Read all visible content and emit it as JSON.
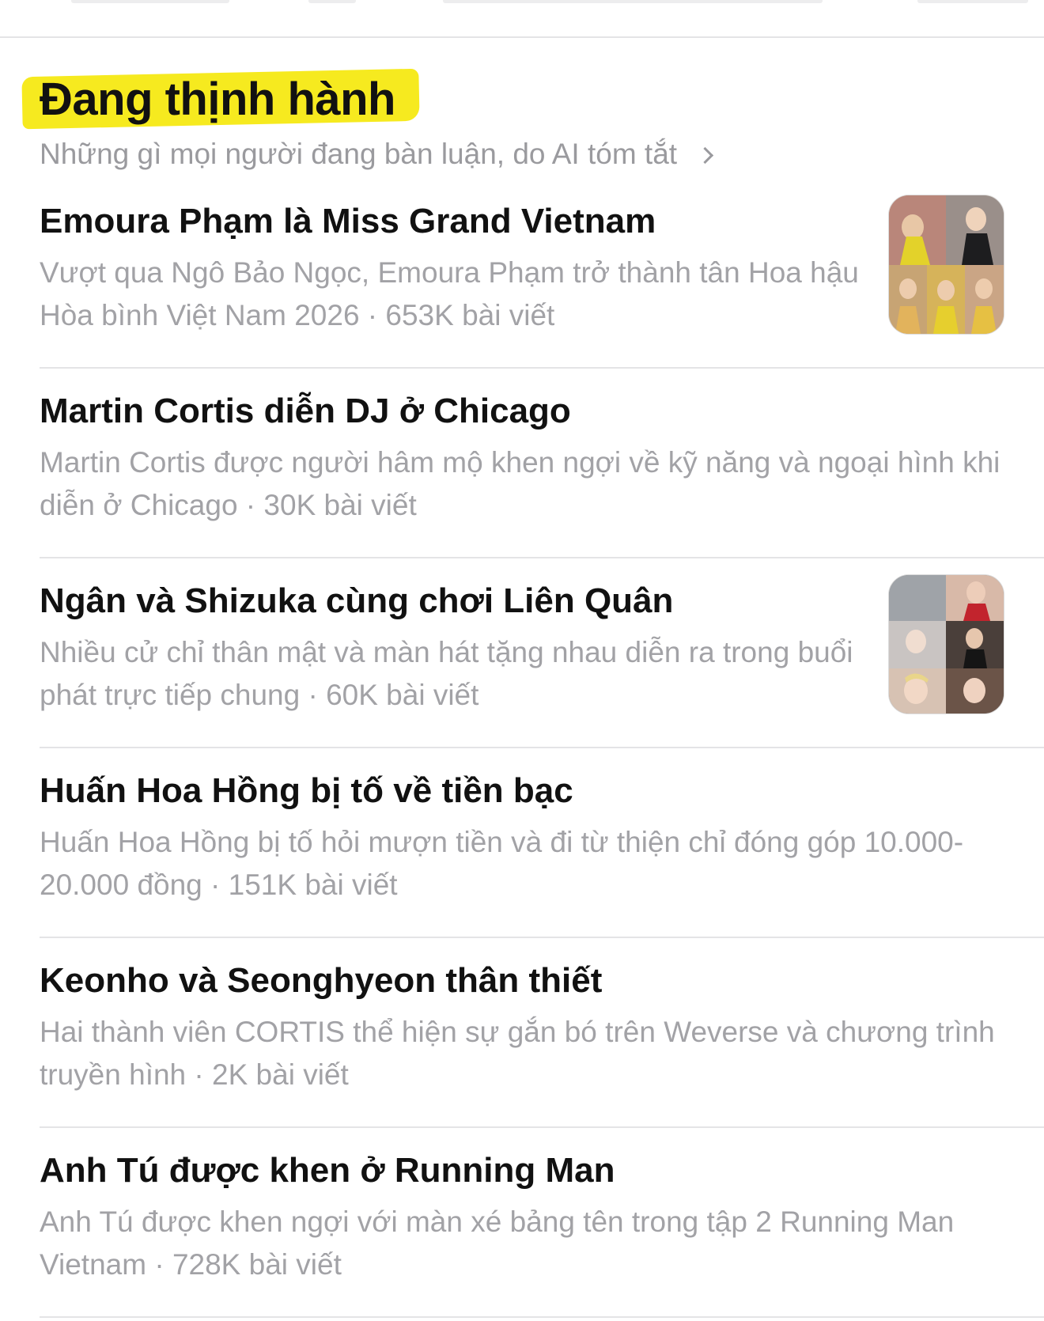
{
  "section": {
    "title": "Đang thịnh hành",
    "subtitle": "Những gì mọi người đang bàn luận, do AI tóm tắt",
    "subtitle_icon": "chevron-right-icon",
    "highlight_color": "#f6ea1f"
  },
  "trends": [
    {
      "title": "Emoura Phạm là Miss Grand Vietnam",
      "description": "Vượt qua Ngô Bảo Ngọc, Emoura Phạm trở thành tân Hoa hậu Hòa bình Việt Nam 2026 · 653K bài viết",
      "has_thumbnail": true
    },
    {
      "title": "Martin Cortis diễn DJ ở Chicago",
      "description": "Martin Cortis được người hâm mộ khen ngợi về kỹ năng và ngoại hình khi diễn ở Chicago · 30K bài viết",
      "has_thumbnail": false
    },
    {
      "title": "Ngân và Shizuka cùng chơi Liên Quân",
      "description": "Nhiều cử chỉ thân mật và màn hát tặng nhau diễn ra trong buổi phát trực tiếp chung · 60K bài viết",
      "has_thumbnail": true
    },
    {
      "title": "Huấn Hoa Hồng bị tố về tiền bạc",
      "description": "Huấn Hoa Hồng bị tố hỏi mượn tiền và đi từ thiện chỉ đóng góp 10.000-20.000 đồng · 151K bài viết",
      "has_thumbnail": false
    },
    {
      "title": "Keonho và Seonghyeon thân thiết",
      "description": "Hai thành viên CORTIS thể hiện sự gắn bó trên Weverse và chương trình truyền hình · 2K bài viết",
      "has_thumbnail": false
    },
    {
      "title": "Anh Tú được khen ở Running Man",
      "description": "Anh Tú được khen ngợi với màn xé bảng tên trong tập 2 Running Man Vietnam · 728K bài viết",
      "has_thumbnail": false
    }
  ]
}
